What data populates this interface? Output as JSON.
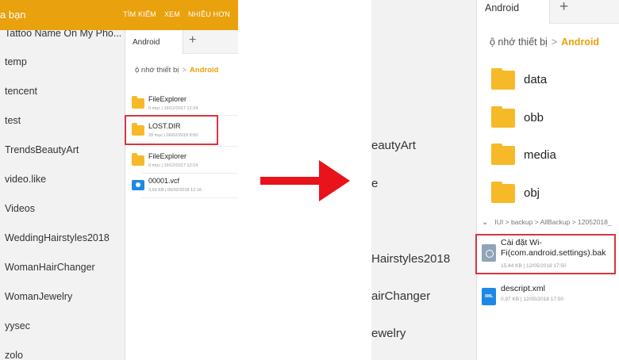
{
  "left": {
    "app_title": "a bạn",
    "actions": [
      "TÌM KIẾM",
      "XEM",
      "NHIỀU HƠN"
    ],
    "list": [
      "Tattoo Name On My Pho...",
      "temp",
      "tencent",
      "test",
      "TrendsBeautyArt",
      "video.like",
      "Videos",
      "WeddingHairstyles2018",
      "WomanHairChanger",
      "WomanJewelry",
      "yysec",
      "zolo"
    ],
    "tab_label": "Android",
    "plus": "+",
    "breadcrumb_root": "ộ nhớ thiết bị",
    "breadcrumb_sep": ">",
    "breadcrumb_current": "Android",
    "items": [
      {
        "name": "FileExplorer",
        "meta": "0 mục  |  19/12/2017 12:24",
        "icon": "folder-icon"
      },
      {
        "name": "LOST.DIR",
        "meta": "39 mục  |  06/02/2018 8:50",
        "icon": "folder-icon"
      },
      {
        "name": "FileExplorer",
        "meta": "0 mục  |  19/12/2017 12:24",
        "icon": "folder-icon"
      },
      {
        "name": "00001.vcf",
        "meta": "3,69 KB  |  06/02/2018 12:16",
        "icon": "contact-file-icon"
      }
    ]
  },
  "right": {
    "list_fragments": [
      "eautyArt",
      "e",
      "Hairstyles2018",
      "airChanger",
      "ewelry"
    ],
    "tab_label": "Android",
    "plus": "+",
    "breadcrumb_root": "ộ nhớ thiết bị",
    "breadcrumb_sep": ">",
    "breadcrumb_current": "Android",
    "folders": [
      "data",
      "obb",
      "media",
      "obj"
    ],
    "path": "IUI > backup > AllBackup > 12052018_",
    "files": [
      {
        "name": "Cài đặt Wi-Fi(com.android.settings).bak",
        "meta": "15,44 KB  |  12/05/2018 17:50",
        "icon": "settings-file-icon"
      },
      {
        "name": "descript.xml",
        "meta": "0,97 KB  |  12/05/2018 17:50",
        "icon": "xml-file-icon",
        "icon_text": "XML"
      }
    ]
  },
  "colors": {
    "accent": "#e9a10d",
    "folder": "#f6b928",
    "highlight": "#d9363e",
    "arrow": "#e8131b"
  }
}
